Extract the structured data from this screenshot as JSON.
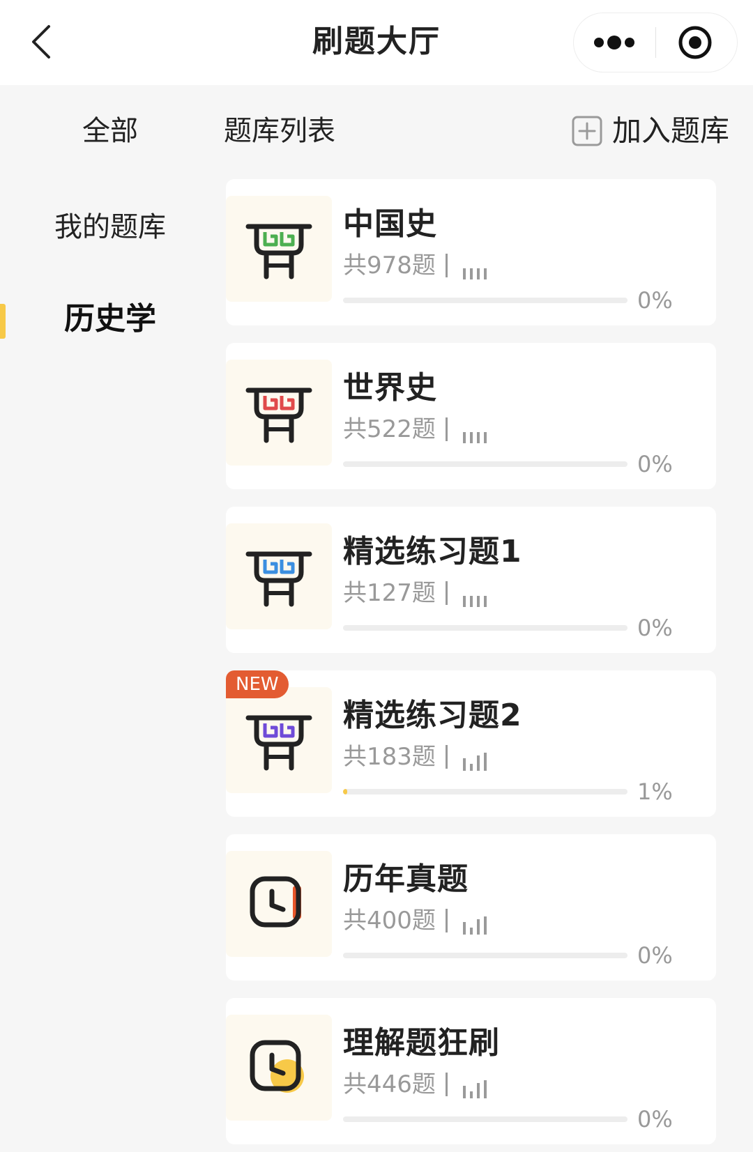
{
  "nav": {
    "title": "刷题大厅"
  },
  "header": {
    "tab_all": "全部",
    "list_title": "题库列表",
    "join_label": "加入题库"
  },
  "sidebar": {
    "items": [
      {
        "label": "我的题库"
      },
      {
        "label": "历史学"
      }
    ]
  },
  "colors": {
    "accent": "#f7c948",
    "badge": "#e35c32",
    "muted": "#999999"
  },
  "cards": [
    {
      "title": "中国史",
      "count": "共978题",
      "percent": "0%",
      "progress": 0,
      "icon": "bookshelf-icon",
      "icon_color": "#4caf50",
      "difficulty": "low"
    },
    {
      "title": "世界史",
      "count": "共522题",
      "percent": "0%",
      "progress": 0,
      "icon": "bookshelf-icon",
      "icon_color": "#e04a4a",
      "difficulty": "low"
    },
    {
      "title": "精选练习题1",
      "count": "共127题",
      "percent": "0%",
      "progress": 0,
      "icon": "bookshelf-icon",
      "icon_color": "#3b8fe0",
      "difficulty": "low"
    },
    {
      "title": "精选练习题2",
      "count": "共183题",
      "percent": "1%",
      "progress": 1,
      "badge": "NEW",
      "icon": "bookshelf-icon",
      "icon_color": "#6f4bd8",
      "difficulty": "mid"
    },
    {
      "title": "历年真题",
      "count": "共400题",
      "percent": "0%",
      "progress": 0,
      "icon": "clock-icon",
      "icon_color": "#e8562a",
      "difficulty": "mid"
    },
    {
      "title": "理解题狂刷",
      "count": "共446题",
      "percent": "0%",
      "progress": 0,
      "icon": "clock-icon",
      "icon_color": "#f7c948",
      "difficulty": "mid"
    }
  ]
}
